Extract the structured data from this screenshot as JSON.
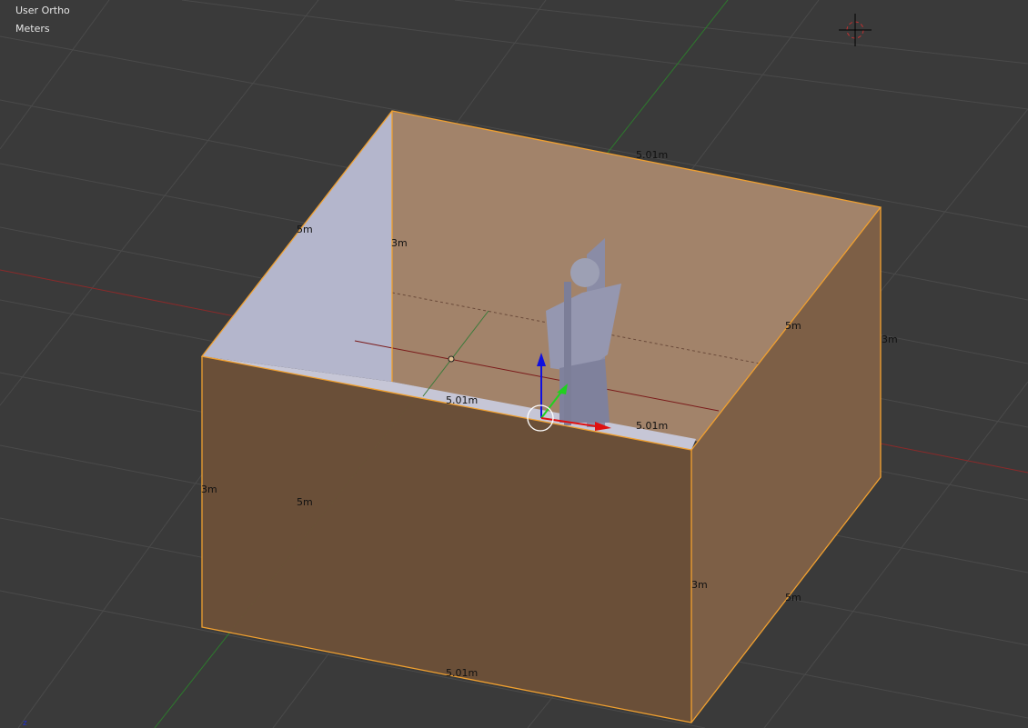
{
  "viewport": {
    "view_name": "User Ortho",
    "units": "Meters"
  },
  "dimensions": {
    "top_back": "5.01m",
    "left_top": "5m",
    "back_left_height": "3m",
    "right_top": "5m",
    "right_height": "3m",
    "floor_back": "5.01m",
    "floor_front": "5.01m",
    "front_left_height": "3m",
    "front_width": "5m",
    "front_right_height": "3m",
    "right_bottom": "5m",
    "bottom_front": "5.01m"
  },
  "colors": {
    "selection": "#f0a030",
    "x_axis": "#e01010",
    "y_axis": "#20d020",
    "z_axis": "#1010e0"
  }
}
